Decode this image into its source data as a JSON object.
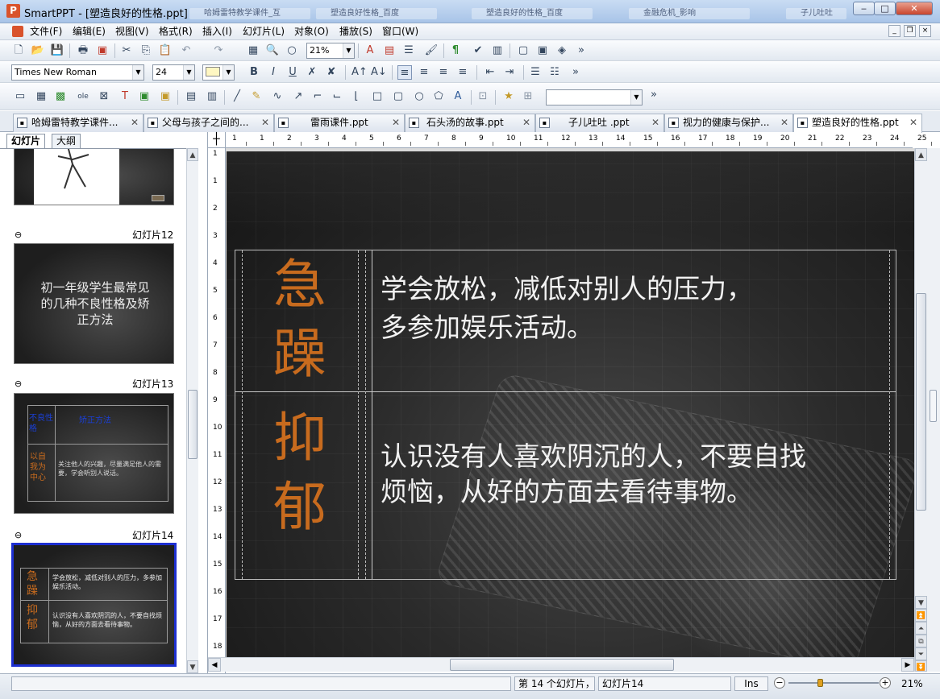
{
  "window": {
    "title": "SmartPPT - [塑造良好的性格.ppt]",
    "app_icon": "P",
    "background_tabs": [
      "哈姆雷特教学课件_互",
      "塑造良好性格_百度",
      "塑造良好的性格_百度",
      "金融危机_影响",
      "子儿吐吐"
    ],
    "minimize": "‒",
    "maximize": "□",
    "close": "✕"
  },
  "menu": {
    "items": [
      "文件(F)",
      "编辑(E)",
      "视图(V)",
      "格式(R)",
      "插入(I)",
      "幻灯片(L)",
      "对象(O)",
      "播放(S)",
      "窗口(W)"
    ],
    "mdi_min": "_",
    "mdi_restore": "❐",
    "mdi_close": "×"
  },
  "toolbar": {
    "zoom": "21%",
    "font_name": "Times New Roman",
    "font_size": "24",
    "overflow": "»",
    "bold": "B",
    "italic": "I",
    "underline": "U"
  },
  "doc_tabs": [
    {
      "label": "哈姆雷特教学课件..."
    },
    {
      "label": "父母与孩子之间的..."
    },
    {
      "label": "雷雨课件.ppt"
    },
    {
      "label": "石头汤的故事.ppt"
    },
    {
      "label": "子儿吐吐 .ppt"
    },
    {
      "label": "视力的健康与保护..."
    },
    {
      "label": "塑造良好的性格.ppt"
    }
  ],
  "doc_tab_close": "✕",
  "panel": {
    "tab_slides": "幻灯片",
    "tab_outline": "大纲",
    "slide12_label": "幻灯片12",
    "slide13_label": "幻灯片13",
    "slide14_label": "幻灯片14",
    "slide12_text": "初一年级学生最常见的几种不良性格及矫正方法",
    "slide13_head1": "不良性格",
    "slide13_head2": "矫正方法",
    "slide13_row_label": "以自我为中心",
    "slide13_row_text": "关注他人的兴趣，尽量满足他人的需要，学会听别人说话。",
    "slide14_row1_label": "急躁",
    "slide14_row1_text": "学会放松，减低对别人的压力，多参加娱乐活动。",
    "slide14_row2_label": "抑郁",
    "slide14_row2_text": "认识没有人喜欢阴沉的人，不要自找烦恼，从好的方面去看待事物。"
  },
  "ruler": {
    "h_ticks": [
      "1",
      "1",
      "2",
      "3",
      "4",
      "5",
      "6",
      "7",
      "8",
      "9",
      "10",
      "11",
      "12",
      "13",
      "14",
      "15",
      "16",
      "17",
      "18",
      "19",
      "20",
      "21",
      "22",
      "23",
      "24",
      "25"
    ],
    "v_ticks": [
      "1",
      "1",
      "2",
      "3",
      "4",
      "5",
      "6",
      "7",
      "8",
      "9",
      "10",
      "11",
      "12",
      "13",
      "14",
      "15",
      "16",
      "17",
      "18"
    ]
  },
  "slide": {
    "row1_label_a": "急",
    "row1_label_b": "躁",
    "row1_line1": "学会放松，减低对别人的压力，",
    "row1_line2": "多参加娱乐活动。",
    "row2_label_a": "抑",
    "row2_label_b": "郁",
    "row2_line1": "认识没有人喜欢阴沉的人，不要自找",
    "row2_line2": "烦恼，从好的方面去看待事物。"
  },
  "status": {
    "slide_count": "第 14 个幻灯片，",
    "current_slide": "幻灯片14",
    "mode": "Ins",
    "zoom": "21%",
    "zoom_level": 0.35
  }
}
